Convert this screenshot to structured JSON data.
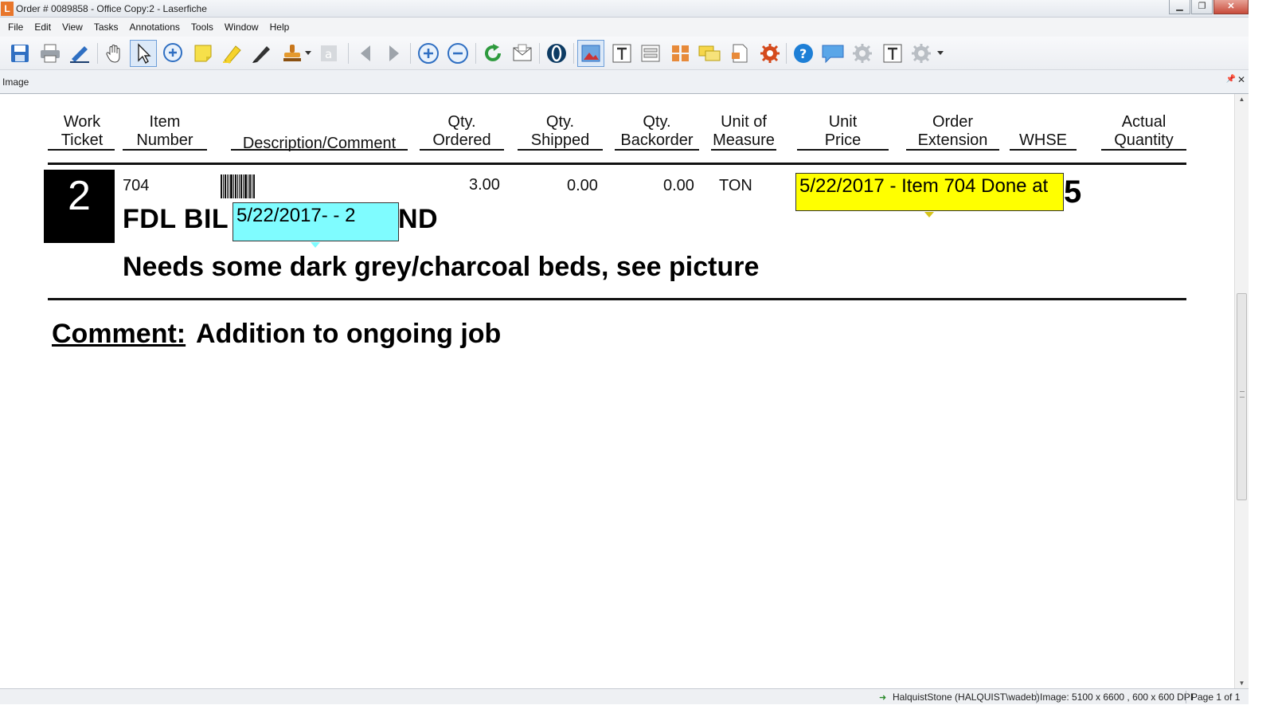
{
  "window": {
    "title": "Order # 0089858 - Office Copy:2 - Laserfiche",
    "logo_letter": "L",
    "buttons": {
      "minimize": "▁",
      "maximize": "❐",
      "close": "✕"
    }
  },
  "menu": [
    "File",
    "Edit",
    "View",
    "Tasks",
    "Annotations",
    "Tools",
    "Window",
    "Help"
  ],
  "toolbar": {
    "icons": [
      "save-icon",
      "print-icon",
      "signature-pen-icon",
      "hand-pan-icon",
      "pointer-select-icon",
      "zoom-select-icon",
      "sticky-note-icon",
      "highlighter-icon",
      "pen-draw-icon",
      "stamp-icon",
      "text-box-icon",
      "previous-page-icon",
      "next-page-icon",
      "zoom-in-icon",
      "zoom-out-icon",
      "refresh-icon",
      "email-icon",
      "ocr-icon",
      "image-view-icon",
      "text-view-icon",
      "fields-icon",
      "thumbnails-icon",
      "annotations-list-icon",
      "metadata-icon",
      "settings-icon",
      "help-icon",
      "comment-icon",
      "options-gear-icon",
      "text-tool-icon",
      "more-gear-icon"
    ],
    "accent": "#1e6fc7"
  },
  "pane": {
    "title": "Image",
    "pin": "📌",
    "close": "✕"
  },
  "document": {
    "columns": [
      {
        "line1": "Work",
        "line2": "Ticket"
      },
      {
        "line1": "Item",
        "line2": "Number"
      },
      {
        "line1": "",
        "line2": "Description/Comment"
      },
      {
        "line1": "Qty.",
        "line2": "Ordered"
      },
      {
        "line1": "Qty.",
        "line2": "Shipped"
      },
      {
        "line1": "Qty.",
        "line2": "Backorder"
      },
      {
        "line1": "Unit of",
        "line2": "Measure"
      },
      {
        "line1": "Unit",
        "line2": "Price"
      },
      {
        "line1": "Order",
        "line2": "Extension"
      },
      {
        "line1": "",
        "line2": "WHSE"
      },
      {
        "line1": "Actual",
        "line2": "Quantity"
      }
    ],
    "row": {
      "ticket": "2",
      "item_number": "704",
      "qty_ordered": "3.00",
      "qty_shipped": "0.00",
      "qty_backorder": "0.00",
      "unit_of_measure": "TON",
      "description_left": "FDL BIL",
      "description_right": "ND",
      "comment_line": "Needs some dark grey/charcoal beds, see picture",
      "actual_quantity": "5"
    },
    "sticky_notes": {
      "cyan": {
        "text": "5/22/2017- -  2",
        "color": "#7ffcff"
      },
      "yellow": {
        "text": "5/22/2017 - Item 704 Done at",
        "color": "#ffff00"
      }
    },
    "comment": {
      "label": "Comment:",
      "text": "Addition to ongoing job"
    }
  },
  "status": {
    "user": "HalquistStone (HALQUIST\\wadeb)",
    "image": "Image: 5100 x 6600 , 600 x 600 DPI",
    "page": "Page 1 of 1"
  }
}
